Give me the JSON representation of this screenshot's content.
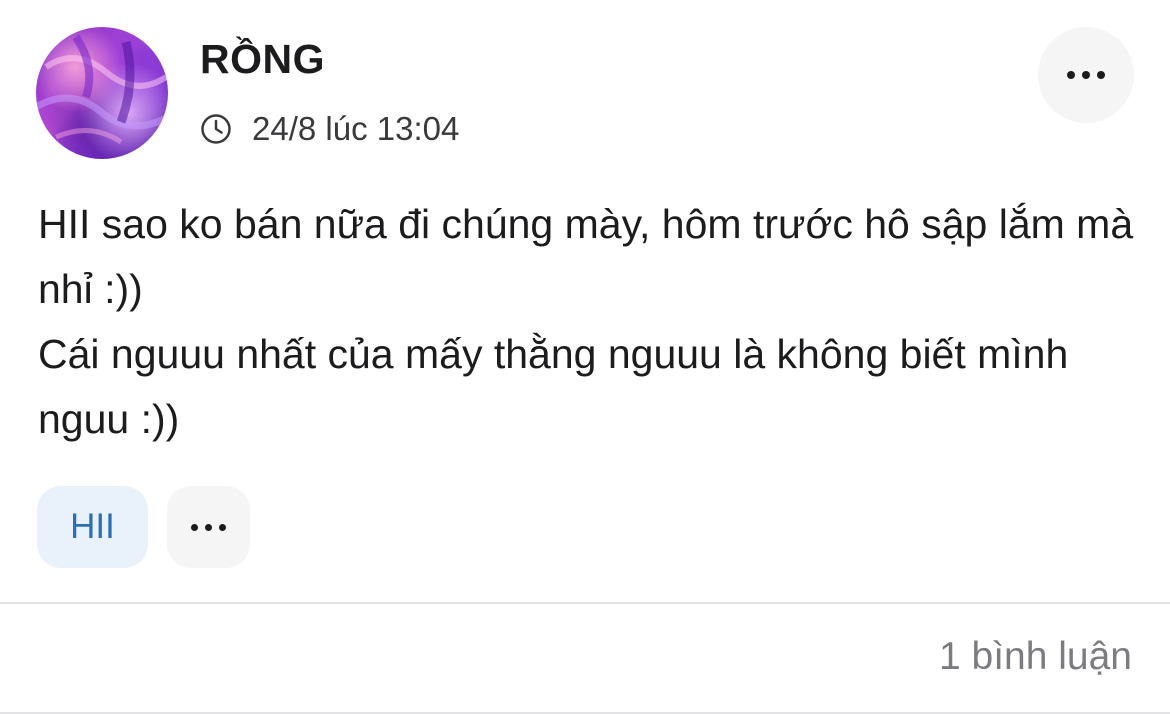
{
  "post": {
    "author": {
      "name": "RỒNG",
      "avatar_icon": "avatar-image"
    },
    "timestamp": "24/8 lúc 13:04",
    "menu_icon": "more-dots-icon",
    "body_lines": [
      "HII sao ko bán nữa đi chúng mày, hôm trước hô sập lắm mà nhỉ :))",
      "Cái nguuu nhất của mấy thằng nguuu là không biết mình nguu :))"
    ],
    "tags": [
      {
        "label": "HII"
      }
    ],
    "comment_count_label": "1 bình luận"
  },
  "colors": {
    "accent_tag_bg": "#e9f2fb",
    "accent_tag_text": "#2d6fb5",
    "muted_text": "#7c7c80"
  }
}
